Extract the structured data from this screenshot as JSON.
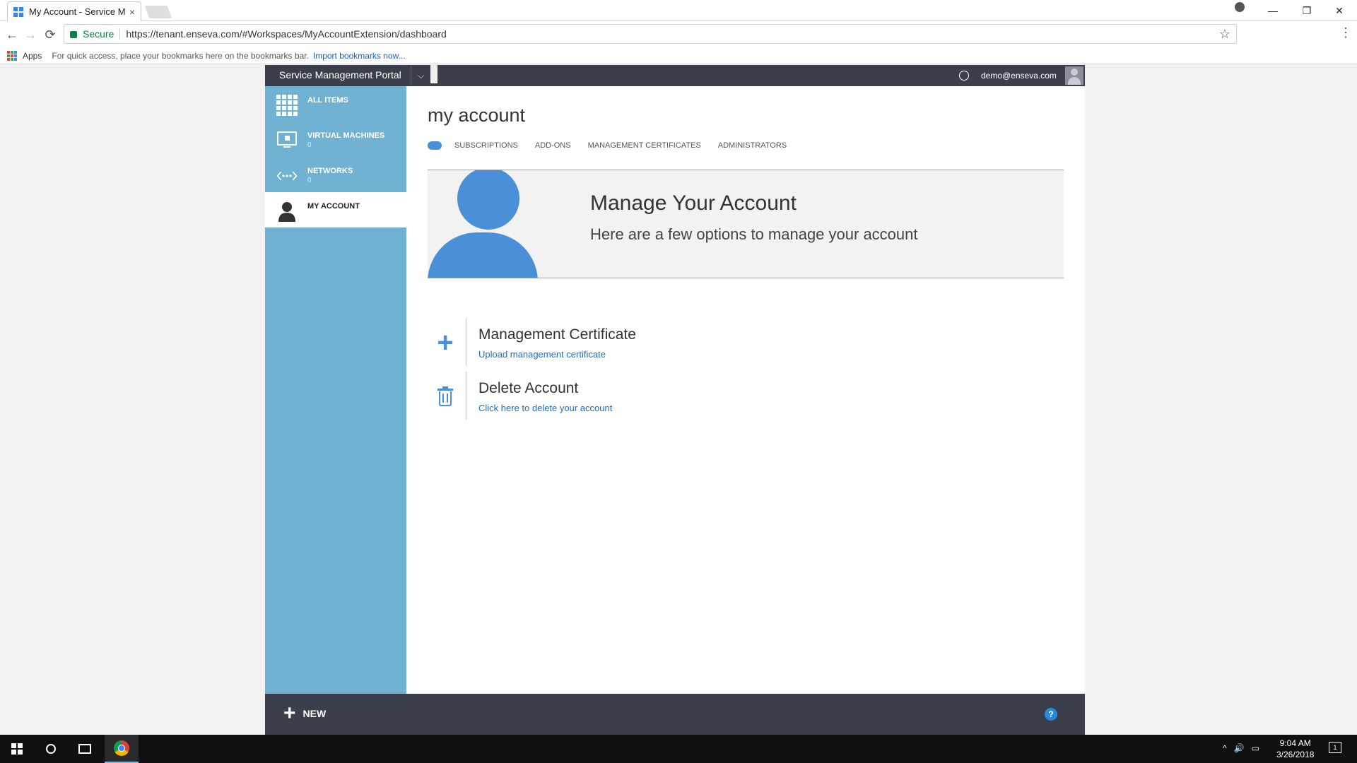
{
  "browser": {
    "tab_title": "My Account - Service Ma",
    "tab_close": "×",
    "window_controls": {
      "minimize": "—",
      "restore": "❐",
      "close": "✕"
    },
    "nav": {
      "back": "←",
      "forward": "→",
      "reload": "⟳"
    },
    "secure_label": "Secure",
    "url": "https://tenant.enseva.com/#Workspaces/MyAccountExtension/dashboard",
    "star": "☆",
    "menu": "⋮",
    "bookmarks": {
      "apps_label": "Apps",
      "hint": "For quick access, place your bookmarks here on the bookmarks bar.",
      "import_link": "Import bookmarks now..."
    }
  },
  "portal": {
    "brand": "Service Management Portal",
    "brand_dropdown": "⌵",
    "user_email": "demo@enseva.com",
    "sidebar": [
      {
        "label": "ALL ITEMS",
        "count": "",
        "icon": "grid-icon"
      },
      {
        "label": "VIRTUAL MACHINES",
        "count": "0",
        "icon": "monitor-icon"
      },
      {
        "label": "NETWORKS",
        "count": "0",
        "icon": "network-icon"
      },
      {
        "label": "MY ACCOUNT",
        "count": "",
        "icon": "user-icon",
        "active": true
      }
    ],
    "page_title": "my account",
    "subnav": [
      "SUBSCRIPTIONS",
      "ADD-ONS",
      "MANAGEMENT CERTIFICATES",
      "ADMINISTRATORS"
    ],
    "hero": {
      "title": "Manage Your Account",
      "subtitle": "Here are a few options to manage your account"
    },
    "actions": [
      {
        "title": "Management Certificate",
        "link": "Upload management certificate",
        "icon": "plus-icon"
      },
      {
        "title": "Delete Account",
        "link": "Click here to delete your account",
        "icon": "trash-icon"
      }
    ],
    "bottom": {
      "new_label": "NEW",
      "new_icon": "+",
      "help": "?"
    }
  },
  "taskbar": {
    "time": "9:04 AM",
    "date": "3/26/2018",
    "tray_icons": [
      "^",
      "🔊",
      "▭"
    ],
    "notification_count": "1"
  },
  "colors": {
    "sidebar": "#71b1d1",
    "bar": "#3a3f4b",
    "accent": "#4a90d9",
    "link": "#1a6ec1"
  }
}
